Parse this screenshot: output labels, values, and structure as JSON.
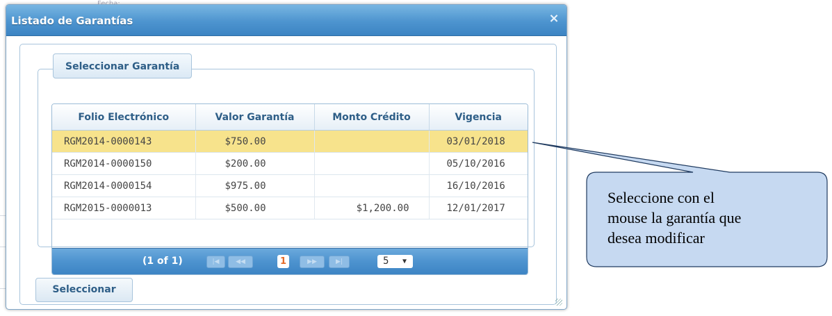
{
  "background": {
    "partial_text": "Fecha:"
  },
  "dialog": {
    "title": "Listado de Garantías",
    "close_symbol": "×",
    "fieldset_legend": "Seleccionar Garantía",
    "table": {
      "columns": [
        "Folio Electrónico",
        "Valor Garantía",
        "Monto Crédito",
        "Vigencia"
      ],
      "rows": [
        {
          "folio": "RGM2014-0000143",
          "valor": "$750.00",
          "monto": "",
          "vigencia": "03/01/2018",
          "selected": true
        },
        {
          "folio": "RGM2014-0000150",
          "valor": "$200.00",
          "monto": "",
          "vigencia": "05/10/2016",
          "selected": false
        },
        {
          "folio": "RGM2014-0000154",
          "valor": "$975.00",
          "monto": "",
          "vigencia": "16/10/2016",
          "selected": false
        },
        {
          "folio": "RGM2015-0000013",
          "valor": "$500.00",
          "monto": "$1,200.00",
          "vigencia": "12/01/2017",
          "selected": false
        }
      ]
    },
    "paginator": {
      "report": "(1 of 1)",
      "first_icon": "first-page-icon",
      "prev_icon": "prev-page-icon",
      "next_icon": "next-page-icon",
      "last_icon": "last-page-icon",
      "current_page": "1",
      "rows_per_page": "5",
      "dropdown_arrow": "▼"
    },
    "select_button": "Seleccionar"
  },
  "callout": {
    "line1": "Seleccione con el",
    "line2": "mouse la garantía que",
    "line3": "desea modificar",
    "fill_color": "#c6d9f1",
    "stroke_color": "#1f3a5f"
  },
  "colors": {
    "titlebar": "#4d94cf",
    "selected_row": "#f7e38c",
    "header_text": "#2e5e87",
    "page_number": "#e46c2a"
  }
}
